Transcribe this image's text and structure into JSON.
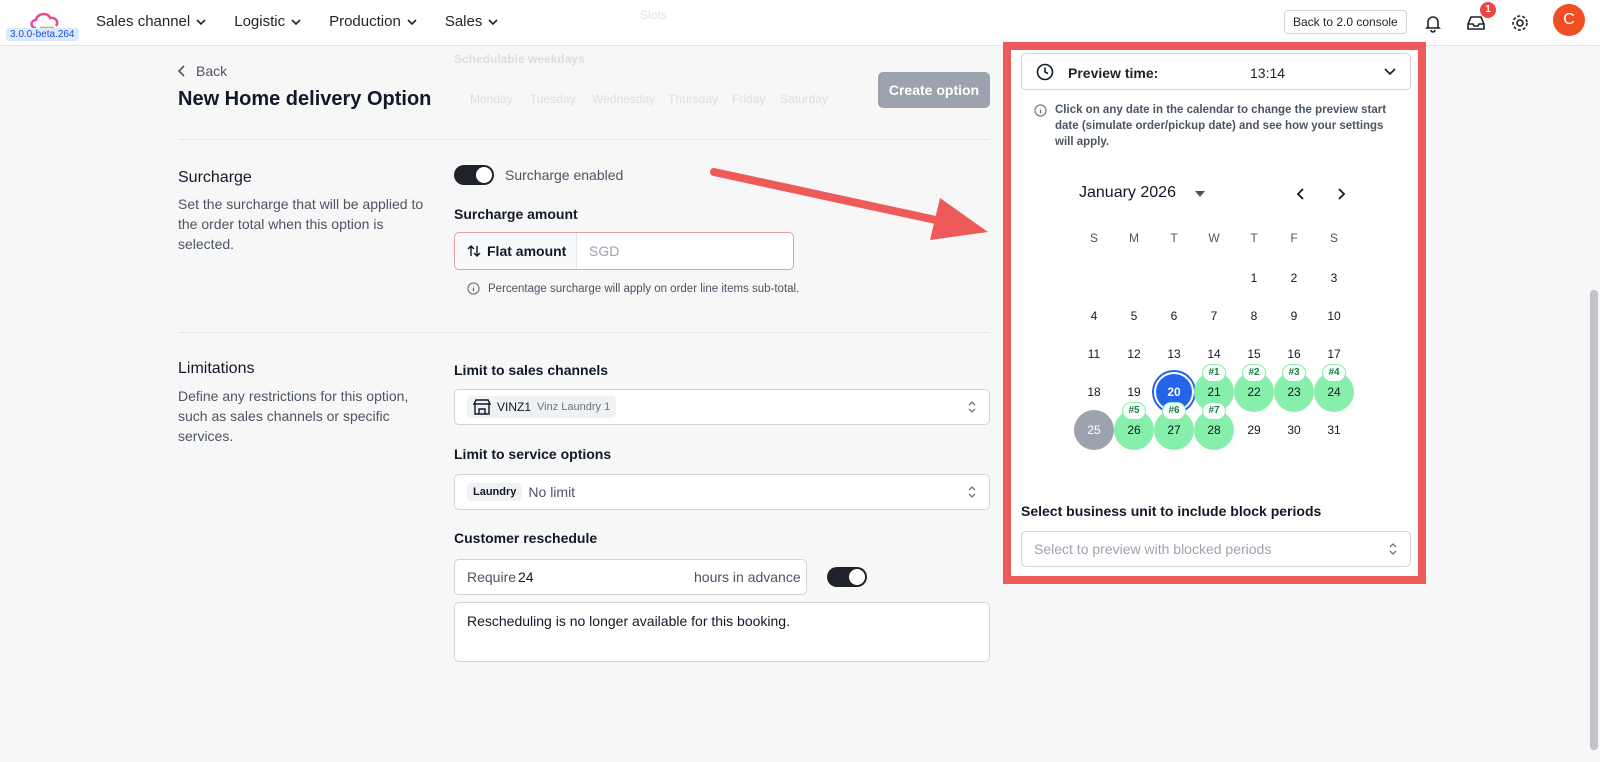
{
  "header": {
    "version": "3.0.0-beta.264",
    "nav": [
      "Sales channel",
      "Logistic",
      "Production",
      "Sales"
    ],
    "console_button": "Back to 2.0 console",
    "inbox_badge": "1",
    "avatar_initial": "C"
  },
  "page": {
    "back_label": "Back",
    "title": "New Home delivery Option",
    "create_button": "Create option"
  },
  "ghost": {
    "schedulable": "Schedulable weekdays",
    "days": [
      "Monday",
      "Tuesday",
      "Wednesday",
      "Thursday",
      "Friday",
      "Saturday"
    ],
    "slot": "Slots"
  },
  "surcharge": {
    "title": "Surcharge",
    "description": "Set the surcharge that will be applied to the order total when this option is selected.",
    "toggle_label": "Surcharge enabled",
    "amount_label": "Surcharge amount",
    "type_button": "Flat amount",
    "currency_placeholder": "SGD",
    "hint": "Percentage surcharge will apply on order line items sub-total."
  },
  "limitations": {
    "title": "Limitations",
    "description": "Define any restrictions for this option, such as sales channels or specific services.",
    "sales_channels_label": "Limit to sales channels",
    "channel_code": "VINZ1",
    "channel_name": "Vinz Laundry 1",
    "service_label": "Limit to service options",
    "service_chip": "Laundry",
    "service_value": "No limit",
    "reschedule_label": "Customer reschedule",
    "require_prefix": "Require",
    "require_value": "24",
    "require_suffix": "hours in advance",
    "reschedule_message": "Rescheduling is no longer available for this booking."
  },
  "preview": {
    "label": "Preview time:",
    "time": "13:14",
    "note": "Click on any date in the calendar to change the preview start date (simulate order/pickup date) and see how your settings will apply.",
    "month": "January 2026",
    "weekdays": [
      "S",
      "M",
      "T",
      "W",
      "T",
      "F",
      "S"
    ],
    "business_unit_label": "Select business unit to include block periods",
    "business_unit_placeholder": "Select to preview with blocked periods"
  },
  "calendar": {
    "weeks": [
      [
        "",
        "",
        "",
        "",
        "1",
        "2",
        "3"
      ],
      [
        "4",
        "5",
        "6",
        "7",
        "8",
        "9",
        "10"
      ],
      [
        "11",
        "12",
        "13",
        "14",
        "15",
        "16",
        "17"
      ],
      [
        "18",
        "19",
        "20",
        "21",
        "22",
        "23",
        "24"
      ],
      [
        "25",
        "26",
        "27",
        "28",
        "29",
        "30",
        "31"
      ]
    ],
    "selected": "20",
    "greyed": "25",
    "slots": [
      {
        "day": "21",
        "tag": "#1"
      },
      {
        "day": "22",
        "tag": "#2"
      },
      {
        "day": "23",
        "tag": "#3"
      },
      {
        "day": "24",
        "tag": "#4"
      },
      {
        "day": "26",
        "tag": "#5"
      },
      {
        "day": "27",
        "tag": "#6"
      },
      {
        "day": "28",
        "tag": "#7"
      }
    ]
  },
  "colors": {
    "accent": "#2563eb",
    "highlight_border": "#ee5a5a",
    "slot_green": "#86efac",
    "avatar": "#f04e23"
  }
}
